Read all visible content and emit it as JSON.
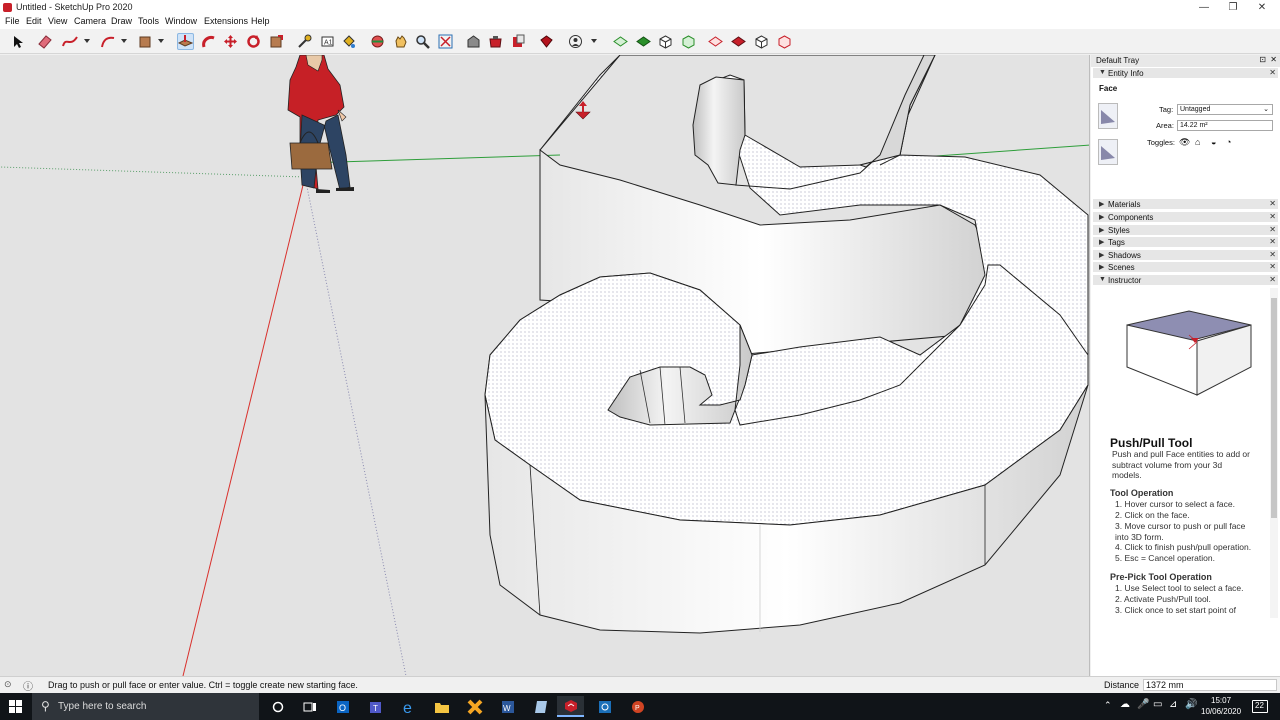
{
  "window": {
    "title": "Untitled - SketchUp Pro 2020"
  },
  "menu": [
    "File",
    "Edit",
    "View",
    "Camera",
    "Draw",
    "Tools",
    "Window",
    "Extensions",
    "Help"
  ],
  "toolbar": {
    "tools": [
      "select-tool",
      "eraser-tool",
      "freehand-tool",
      "pencil-arc-tool",
      "rectangle-tool",
      "push-pull-tool",
      "follow-me-tool",
      "move-tool",
      "rotate-tool",
      "scale-tool",
      "tape-measure-tool",
      "text-tool",
      "paint-bucket-tool",
      "orbit-tool",
      "pan-tool",
      "zoom-tool",
      "zoom-extents-tool",
      "warehouse-tool",
      "extension-warehouse-tool",
      "layout-send-tool",
      "ruby-tool",
      "position-camera-tool"
    ],
    "view_tools": [
      "iso-view",
      "top-view",
      "front-view",
      "right-view",
      "back-view",
      "left-view"
    ]
  },
  "viewport": {
    "push_pull_active": true
  },
  "tray": {
    "title": "Default Tray",
    "entity_info": {
      "header": "Entity Info",
      "selection": "Face",
      "tag_label": "Tag:",
      "tag_value": "Untagged",
      "area_label": "Area:",
      "area_value": "14.22 m²",
      "toggles_label": "Toggles:"
    },
    "sections": [
      "Materials",
      "Components",
      "Styles",
      "Tags",
      "Shadows",
      "Scenes",
      "Instructor"
    ],
    "instructor": {
      "title": "Push/Pull Tool",
      "description": "Push and pull Face entities to add or subtract volume from your 3d models.",
      "op_header": "Tool Operation",
      "op_steps": [
        "1. Hover cursor to select a face.",
        "2. Click on the face.",
        "3. Move cursor to push or pull face into 3D form.",
        "4. Click to finish push/pull operation.",
        "5. Esc = Cancel operation."
      ],
      "prepick_header": "Pre-Pick Tool Operation",
      "prepick_steps": [
        "1. Use Select tool to select a face.",
        "2. Activate Push/Pull tool.",
        "3. Click once to set start point of"
      ]
    }
  },
  "statusbar": {
    "message": "Drag to push or pull face or enter value.  Ctrl = toggle create new starting face.",
    "distance_label": "Distance",
    "distance_value": "1372 mm"
  },
  "taskbar": {
    "search_placeholder": "Type here to search",
    "time": "15:07",
    "date": "10/06/2020",
    "notification_count": "22"
  },
  "colors": {
    "red_axis": "#d9302c",
    "green_axis": "#2e9e3a",
    "accent": "#0078d7"
  }
}
